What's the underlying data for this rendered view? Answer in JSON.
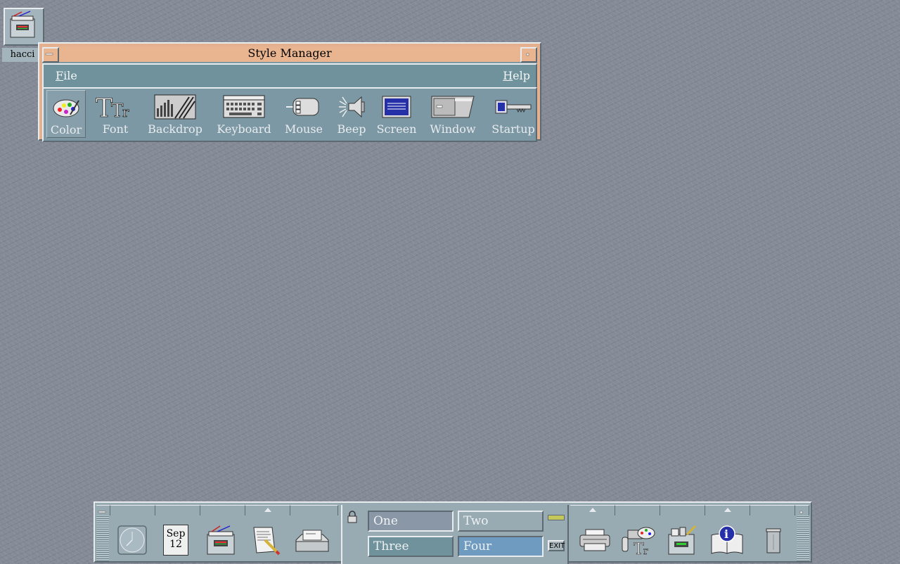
{
  "desktop": {
    "icon_label": "hacci"
  },
  "style_manager": {
    "title": "Style Manager",
    "menus": {
      "file": "File",
      "file_mnemonic": "F",
      "file_rest": "ile",
      "help": "Help",
      "help_mnemonic": "H",
      "help_rest": "elp"
    },
    "tools": [
      {
        "label": "Color",
        "icon": "palette-icon",
        "selected": true
      },
      {
        "label": "Font",
        "icon": "font-icon"
      },
      {
        "label": "Backdrop",
        "icon": "backdrop-icon"
      },
      {
        "label": "Keyboard",
        "icon": "keyboard-icon"
      },
      {
        "label": "Mouse",
        "icon": "mouse-icon"
      },
      {
        "label": "Beep",
        "icon": "speaker-icon"
      },
      {
        "label": "Screen",
        "icon": "screen-icon"
      },
      {
        "label": "Window",
        "icon": "window-icon"
      },
      {
        "label": "Startup",
        "icon": "key-icon"
      }
    ]
  },
  "front_panel": {
    "calendar": {
      "month": "Sep",
      "day": "12"
    },
    "workspaces": {
      "one": "One",
      "two": "Two",
      "three": "Three",
      "four": "Four",
      "current": "Four"
    },
    "exit_label": "EXIT",
    "left_icons": [
      "clock-icon",
      "calendar-icon",
      "file-manager-icon",
      "text-editor-icon",
      "mailer-icon"
    ],
    "right_icons": [
      "printer-icon",
      "style-manager-icon",
      "application-manager-icon",
      "help-icon",
      "trash-icon"
    ]
  },
  "colors": {
    "window_frame": "#e3b18f",
    "window_body": "#7c98a4",
    "panel": "#98aab2",
    "desktop": "#858a97",
    "active_workspace": "#6e9bbf"
  }
}
